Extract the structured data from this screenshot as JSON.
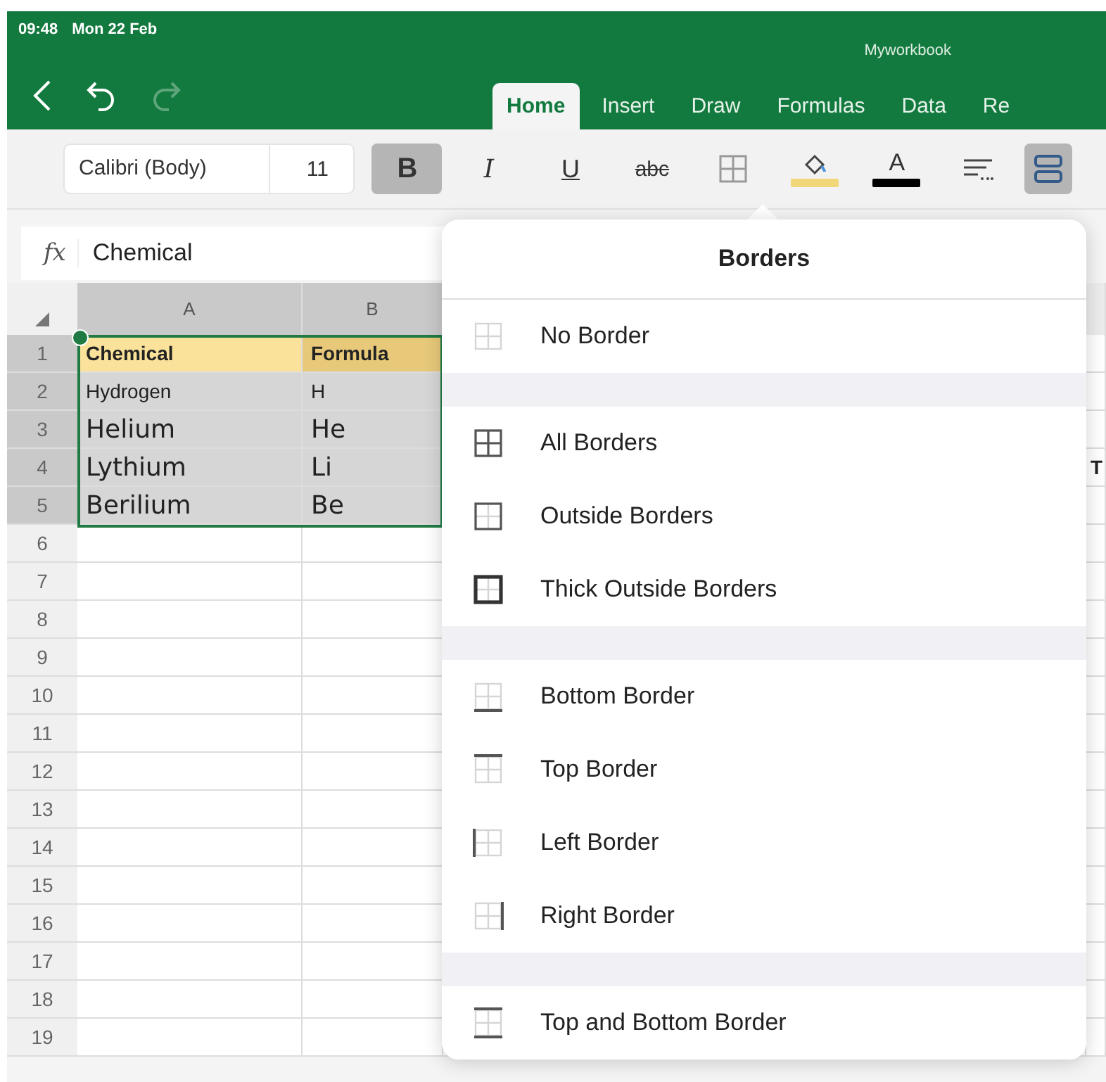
{
  "status_bar": {
    "time": "09:48",
    "date": "Mon 22 Feb"
  },
  "window": {
    "title": "Myworkbook"
  },
  "nav": [
    {
      "kind": "back",
      "disabled": false
    },
    {
      "kind": "undo",
      "disabled": false
    },
    {
      "kind": "redo",
      "disabled": true
    }
  ],
  "tabs": [
    {
      "label": "Home",
      "selected": true
    },
    {
      "label": "Insert",
      "selected": false
    },
    {
      "label": "Draw",
      "selected": false
    },
    {
      "label": "Formulas",
      "selected": false
    },
    {
      "label": "Data",
      "selected": false
    },
    {
      "label": "Re",
      "selected": false
    }
  ],
  "toolbar": {
    "font_name": "Calibri (Body)",
    "font_size": "11",
    "buttons": [
      {
        "kind": "bold",
        "label": "B",
        "selected": true
      },
      {
        "kind": "italic",
        "label": "I",
        "selected": false
      },
      {
        "kind": "underline",
        "label": "U",
        "selected": false
      },
      {
        "kind": "strike",
        "label": "abc",
        "selected": false
      },
      {
        "kind": "borders",
        "selected": false
      },
      {
        "kind": "fill",
        "color": "#f1d67a",
        "selected": false
      },
      {
        "kind": "font_color",
        "label": "A",
        "color": "#000000",
        "selected": false
      },
      {
        "kind": "align",
        "selected": false
      },
      {
        "kind": "wrap",
        "selected": true
      }
    ]
  },
  "formula_bar": {
    "label": "fx",
    "value": "Chemical"
  },
  "sheet": {
    "columns": [
      {
        "label": "A",
        "selected": true
      },
      {
        "label": "B",
        "selected": true
      }
    ],
    "rows": [
      {
        "number": "1",
        "kind": "header",
        "selected": true,
        "cells": [
          "Chemical",
          "Formula"
        ]
      },
      {
        "number": "2",
        "kind": "plain",
        "selected": true,
        "cells": [
          "Hydrogen",
          "H"
        ]
      },
      {
        "number": "3",
        "kind": "large",
        "selected": true,
        "cells": [
          "Helium",
          "He"
        ]
      },
      {
        "number": "4",
        "kind": "large",
        "selected": true,
        "cells": [
          "Lythium",
          "Li"
        ],
        "column_4": "T"
      },
      {
        "number": "5",
        "kind": "large",
        "selected": true,
        "cells": [
          "Berilium",
          "Be"
        ]
      },
      {
        "number": "6",
        "selected": false,
        "cells": []
      },
      {
        "number": "7",
        "selected": false,
        "cells": []
      },
      {
        "number": "8",
        "selected": false,
        "cells": []
      },
      {
        "number": "9",
        "selected": false,
        "cells": []
      },
      {
        "number": "10",
        "selected": false,
        "cells": []
      },
      {
        "number": "11",
        "selected": false,
        "cells": []
      },
      {
        "number": "12",
        "selected": false,
        "cells": []
      },
      {
        "number": "13",
        "selected": false,
        "cells": []
      },
      {
        "number": "14",
        "selected": false,
        "cells": []
      },
      {
        "number": "15",
        "selected": false,
        "cells": []
      },
      {
        "number": "16",
        "selected": false,
        "cells": []
      },
      {
        "number": "17",
        "selected": false,
        "cells": []
      },
      {
        "number": "18",
        "selected": false,
        "cells": []
      },
      {
        "number": "19",
        "selected": false,
        "cells": []
      }
    ]
  },
  "borders_menu": {
    "title": "Borders",
    "groups": [
      {
        "items": [
          {
            "kind": "none",
            "label": "No Border"
          }
        ]
      },
      {
        "items": [
          {
            "kind": "all",
            "label": "All Borders"
          },
          {
            "kind": "outside",
            "label": "Outside Borders"
          },
          {
            "kind": "thick",
            "label": "Thick Outside Borders"
          }
        ]
      },
      {
        "items": [
          {
            "kind": "bottom",
            "label": "Bottom Border"
          },
          {
            "kind": "top",
            "label": "Top Border"
          },
          {
            "kind": "left",
            "label": "Left Border"
          },
          {
            "kind": "right",
            "label": "Right Border"
          }
        ]
      },
      {
        "items": [
          {
            "kind": "topbottom",
            "label": "Top and Bottom Border"
          }
        ]
      }
    ]
  }
}
